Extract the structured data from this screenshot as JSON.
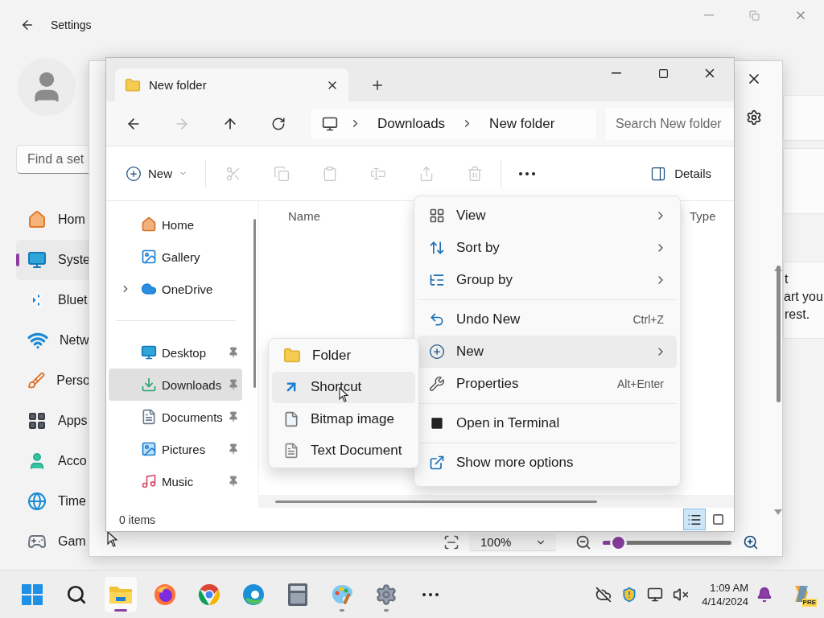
{
  "settings": {
    "title": "Settings",
    "search": {
      "placeholder": "Find a set"
    },
    "nav": [
      {
        "kind": "home",
        "label": "Hom",
        "selected": false
      },
      {
        "kind": "system",
        "label": "Syste",
        "selected": true
      },
      {
        "kind": "bluetooth",
        "label": "Bluet",
        "selected": false
      },
      {
        "kind": "network",
        "label": "Netw",
        "selected": false
      },
      {
        "kind": "personalization",
        "label": "Perso",
        "selected": false
      },
      {
        "kind": "apps",
        "label": "Apps",
        "selected": false
      },
      {
        "kind": "accounts",
        "label": "Acco",
        "selected": false
      },
      {
        "kind": "time",
        "label": "Time",
        "selected": false
      },
      {
        "kind": "gaming",
        "label": "Gam",
        "selected": false
      }
    ],
    "panel_text": [
      "t",
      "art you",
      "rest."
    ]
  },
  "paint": {
    "zoom": {
      "value": "100%",
      "level": 0.12
    }
  },
  "explorer": {
    "tab": {
      "title": "New folder"
    },
    "breadcrumb": [
      "Downloads",
      "New folder"
    ],
    "search": {
      "placeholder": "Search New folder"
    },
    "commands": {
      "new": "New",
      "details": "Details",
      "actions": [
        {
          "kind": "cut",
          "disabled": true
        },
        {
          "kind": "copy",
          "disabled": true
        },
        {
          "kind": "paste",
          "disabled": true
        },
        {
          "kind": "rename",
          "disabled": true
        },
        {
          "kind": "share",
          "disabled": true
        },
        {
          "kind": "delete",
          "disabled": true
        }
      ]
    },
    "nav_groups": [
      [
        {
          "kind": "home",
          "label": "Home",
          "selected": false,
          "pinned": false,
          "expandable": false
        },
        {
          "kind": "gallery",
          "label": "Gallery",
          "selected": false,
          "pinned": false,
          "expandable": false
        },
        {
          "kind": "onedrive",
          "label": "OneDrive",
          "selected": false,
          "pinned": false,
          "expandable": true
        }
      ],
      [
        {
          "kind": "desktop",
          "label": "Desktop",
          "selected": false,
          "pinned": true,
          "expandable": false
        },
        {
          "kind": "downloads",
          "label": "Downloads",
          "selected": true,
          "pinned": true,
          "expandable": false
        },
        {
          "kind": "documents",
          "label": "Documents",
          "selected": false,
          "pinned": true,
          "expandable": false
        },
        {
          "kind": "pictures",
          "label": "Pictures",
          "selected": false,
          "pinned": true,
          "expandable": false
        },
        {
          "kind": "music",
          "label": "Music",
          "selected": false,
          "pinned": true,
          "expandable": false
        }
      ]
    ],
    "columns": [
      "Name",
      "Type"
    ],
    "status": "0 items",
    "views": [
      {
        "kind": "details",
        "selected": true
      },
      {
        "kind": "tiles",
        "selected": false
      }
    ]
  },
  "context_menu": {
    "groups": [
      [
        {
          "kind": "view",
          "label": "View",
          "submenu": true,
          "selected": false
        },
        {
          "kind": "sort",
          "label": "Sort by",
          "submenu": true,
          "selected": false
        },
        {
          "kind": "group",
          "label": "Group by",
          "submenu": true,
          "selected": false
        }
      ],
      [
        {
          "kind": "undo",
          "label": "Undo New",
          "shortcut": "Ctrl+Z",
          "submenu": false,
          "selected": false
        },
        {
          "kind": "new",
          "label": "New",
          "submenu": true,
          "selected": true
        },
        {
          "kind": "properties",
          "label": "Properties",
          "shortcut": "Alt+Enter",
          "submenu": false,
          "selected": false
        }
      ],
      [
        {
          "kind": "terminal",
          "label": "Open in Terminal",
          "submenu": false,
          "selected": false
        }
      ],
      [
        {
          "kind": "more",
          "label": "Show more options",
          "submenu": false,
          "selected": false
        }
      ]
    ]
  },
  "new_submenu": [
    {
      "kind": "folder",
      "label": "Folder",
      "selected": false
    },
    {
      "kind": "shortcut",
      "label": "Shortcut",
      "selected": true
    },
    {
      "kind": "bitmap",
      "label": "Bitmap image",
      "selected": false
    },
    {
      "kind": "text",
      "label": "Text Document",
      "selected": false
    }
  ],
  "taskbar": {
    "apps": [
      {
        "kind": "start",
        "selected": false,
        "running": false
      },
      {
        "kind": "search",
        "selected": false,
        "running": false
      },
      {
        "kind": "explorer",
        "selected": true,
        "running": true
      },
      {
        "kind": "firefox",
        "selected": false,
        "running": false
      },
      {
        "kind": "chrome",
        "selected": false,
        "running": false
      },
      {
        "kind": "edge",
        "selected": false,
        "running": false
      },
      {
        "kind": "calculator",
        "selected": false,
        "running": false
      },
      {
        "kind": "paint",
        "selected": false,
        "running": true
      },
      {
        "kind": "settings",
        "selected": false,
        "running": true
      },
      {
        "kind": "more",
        "selected": false,
        "running": false
      }
    ],
    "tray": [
      {
        "kind": "cloud"
      },
      {
        "kind": "security"
      },
      {
        "kind": "network"
      },
      {
        "kind": "mute"
      }
    ],
    "clock": {
      "time": "1:09 AM",
      "date": "4/14/2024"
    },
    "copilot": {
      "badge": "PRE"
    }
  }
}
